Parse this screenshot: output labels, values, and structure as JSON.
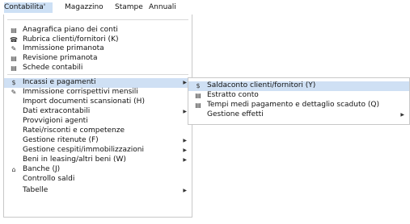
{
  "menubar": {
    "items": [
      {
        "label": "Contabilita'"
      },
      {
        "label": "Magazzino"
      },
      {
        "label": "Stampe"
      },
      {
        "label": "Annuali"
      }
    ]
  },
  "main_menu": {
    "items": [
      {
        "label": "Anagrafica piano dei conti",
        "icon": "document-icon"
      },
      {
        "label": "Rubrica clienti/fornitori (K)",
        "icon": "contacts-icon"
      },
      {
        "label": "Immissione primanota",
        "icon": "entry-icon"
      },
      {
        "label": "Revisione primanota",
        "icon": "document-icon"
      },
      {
        "label": "Schede contabili",
        "icon": "document-icon"
      },
      {
        "label": "Incassi e pagamenti",
        "icon": "money-icon",
        "submenu": true,
        "highlighted": true
      },
      {
        "label": "Immissione corrispettivi mensili",
        "icon": "entry-icon"
      },
      {
        "label": "Import documenti scansionati (H)"
      },
      {
        "label": "Dati extracontabili",
        "submenu": true
      },
      {
        "label": "Provvigioni agenti"
      },
      {
        "label": "Ratei/risconti e competenze"
      },
      {
        "label": "Gestione ritenute (F)",
        "submenu": true
      },
      {
        "label": "Gestione cespiti/immobilizzazioni",
        "submenu": true
      },
      {
        "label": "Beni in leasing/altri beni (W)",
        "submenu": true
      },
      {
        "label": "Banche (J)",
        "icon": "bank-icon"
      },
      {
        "label": "Controllo saldi"
      },
      {
        "label": "Tabelle",
        "submenu": true
      }
    ]
  },
  "sub_menu": {
    "items": [
      {
        "label": "Saldaconto clienti/fornitori (Y)",
        "icon": "money-icon",
        "highlighted": true
      },
      {
        "label": "Estratto conto",
        "icon": "document-icon"
      },
      {
        "label": "Tempi medi pagamento e dettaglio scaduto (Q)",
        "icon": "document-icon"
      },
      {
        "label": "Gestione effetti",
        "submenu": true
      }
    ]
  },
  "glyphs": {
    "document-icon": "▤",
    "contacts-icon": "☎",
    "entry-icon": "✎",
    "money-icon": "$",
    "bank-icon": "⌂",
    "arrow": "▶"
  }
}
